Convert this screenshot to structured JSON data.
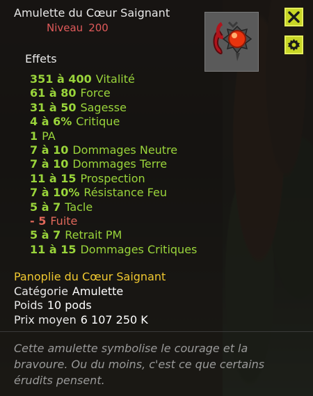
{
  "item": {
    "name": "Amulette du Cœur Saignant",
    "level_label": "Niveau",
    "level_value": "200"
  },
  "icons": {
    "close": "close-icon",
    "settings": "gear-icon",
    "item": "amulet-icon"
  },
  "colors": {
    "positive": "#9ad53b",
    "negative": "#e0685a",
    "set": "#f0c830",
    "button": "#c8d626"
  },
  "effects": {
    "heading": "Effets",
    "lines": [
      {
        "value": "351 à 400",
        "stat": "Vitalité",
        "negative": false
      },
      {
        "value": "61 à 80",
        "stat": "Force",
        "negative": false
      },
      {
        "value": "31 à 50",
        "stat": "Sagesse",
        "negative": false
      },
      {
        "value": "4 à 6%",
        "stat": "Critique",
        "negative": false
      },
      {
        "value": "1",
        "stat": "PA",
        "negative": false
      },
      {
        "value": "7 à 10",
        "stat": "Dommages Neutre",
        "negative": false
      },
      {
        "value": "7 à 10",
        "stat": "Dommages Terre",
        "negative": false
      },
      {
        "value": "11 à 15",
        "stat": "Prospection",
        "negative": false
      },
      {
        "value": "7 à 10%",
        "stat": "Résistance Feu",
        "negative": false
      },
      {
        "value": "5 à 7",
        "stat": "Tacle",
        "negative": false
      },
      {
        "value": "- 5",
        "stat": "Fuite",
        "negative": true
      },
      {
        "value": "5 à 7",
        "stat": "Retrait PM",
        "negative": false
      },
      {
        "value": "11 à 15",
        "stat": "Dommages Critiques",
        "negative": false
      }
    ]
  },
  "set_name": "Panoplie du Cœur Saignant",
  "details": {
    "category_label": "Catégorie",
    "category_value": "Amulette",
    "weight_label": "Poids",
    "weight_value": "10 pods",
    "price_label": "Prix moyen",
    "price_value": "6 107 250 K"
  },
  "description": "Cette amulette symbolise le courage et la bravoure. Ou du moins, c'est ce que certains érudits pensent."
}
